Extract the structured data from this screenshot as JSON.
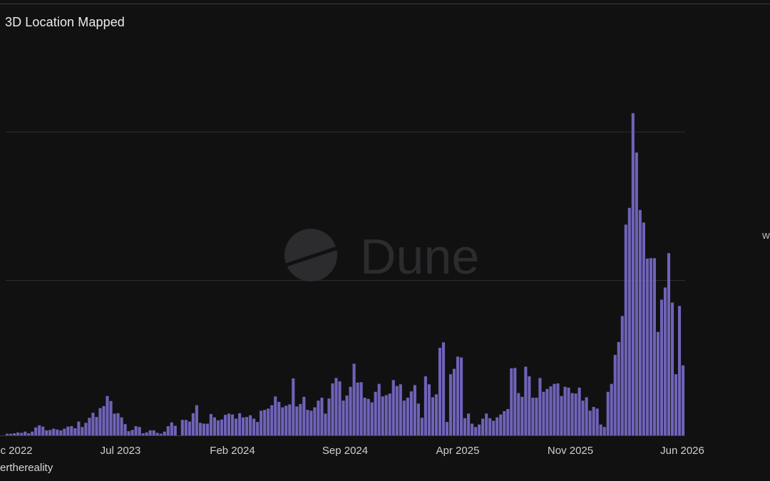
{
  "chart_data": {
    "type": "bar",
    "title": "3D Location Mapped",
    "x_tick_labels": [
      "c 2022",
      "Jul 2023",
      "Feb 2024",
      "Sep 2024",
      "Apr 2025",
      "Nov 2025",
      "Jun 2026"
    ],
    "y_label_partial": "w",
    "credit": "erthereality",
    "watermark": "Dune",
    "bar_color": "#6f63b8",
    "grid": true,
    "ylim": [
      0,
      100
    ],
    "values": [
      0.4,
      0.4,
      0.5,
      0.7,
      0.6,
      0.9,
      0.5,
      0.9,
      1.9,
      2.4,
      2.1,
      1.2,
      1.3,
      1.6,
      1.4,
      1.2,
      1.6,
      2.1,
      2.2,
      1.7,
      3.3,
      2.0,
      3.0,
      4.2,
      5.4,
      4.4,
      6.5,
      7.0,
      9.4,
      8.2,
      5.2,
      5.3,
      4.3,
      2.7,
      1.0,
      1.3,
      2.2,
      2.0,
      0.5,
      0.7,
      1.2,
      1.2,
      0.6,
      0.4,
      0.9,
      2.2,
      3.1,
      2.3,
      0,
      3.7,
      3.7,
      3.3,
      5.3,
      7.2,
      3.0,
      2.8,
      2.8,
      5.1,
      4.3,
      3.6,
      3.8,
      4.9,
      5.2,
      5.0,
      4.0,
      5.3,
      4.3,
      4.4,
      4.8,
      4.0,
      3.2,
      5.9,
      6.1,
      6.4,
      7.2,
      9.3,
      8.0,
      6.7,
      7.1,
      7.4,
      13.6,
      6.9,
      7.5,
      9.2,
      6.1,
      5.9,
      6.7,
      8.3,
      9.0,
      5.2,
      8.8,
      12.4,
      13.7,
      12.9,
      8.3,
      9.5,
      11.6,
      17.1,
      12.6,
      12.7,
      9.0,
      8.7,
      7.9,
      10.4,
      12.3,
      9.3,
      9.6,
      10.0,
      13.2,
      11.8,
      12.2,
      8.3,
      9.0,
      10.5,
      12.0,
      7.6,
      4.2,
      14.1,
      12.2,
      9.1,
      9.8,
      20.9,
      22.2,
      3.2,
      14.6,
      15.9,
      18.8,
      18.6,
      4.1,
      5.2,
      2.8,
      2.0,
      2.6,
      4.0,
      5.2,
      4.1,
      3.5,
      4.3,
      5.0,
      5.8,
      6.3,
      16.0,
      16.1,
      10.1,
      9.2,
      16.4,
      14.1,
      9.0,
      9.0,
      13.7,
      10.4,
      11.1,
      11.7,
      12.3,
      12.4,
      9.4,
      11.6,
      11.4,
      10.1,
      10.0,
      11.4,
      8.3,
      9.1,
      5.9,
      6.8,
      6.4,
      2.6,
      2.0,
      10.4,
      12.3,
      19.2,
      22.3,
      28.5,
      50.3,
      54.3,
      76.9,
      67.5,
      53.8,
      50.8,
      42.2,
      42.3,
      42.3,
      24.7,
      32.4,
      35.3,
      43.5,
      31.7,
      14.6,
      30.9,
      16.7
    ],
    "gridline_values": [
      37.0,
      72.4
    ]
  }
}
